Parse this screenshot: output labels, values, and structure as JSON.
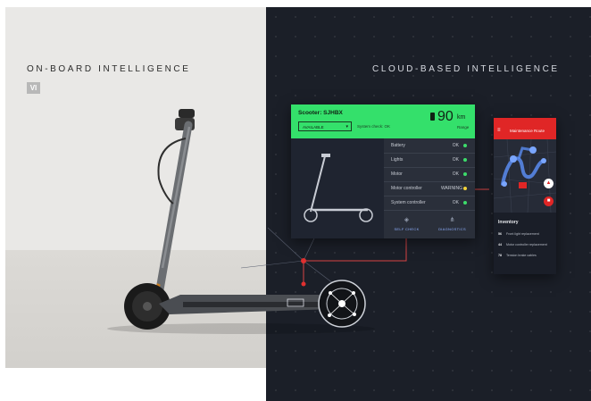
{
  "headers": {
    "left": "ON-BOARD INTELLIGENCE",
    "right": "CLOUD-BASED INTELLIGENCE",
    "badge": "VI"
  },
  "dashboard": {
    "title": "Scooter: SJHBX",
    "status": "AVAILABLE",
    "system_check": "System check: OK",
    "range_value": "90",
    "range_unit": "km",
    "range_label": "Range",
    "components": [
      {
        "name": "Battery",
        "status": "OK",
        "color": "#3ddc6b"
      },
      {
        "name": "Lights",
        "status": "OK",
        "color": "#3ddc6b"
      },
      {
        "name": "Motor",
        "status": "OK",
        "color": "#3ddc6b"
      },
      {
        "name": "Motor controller",
        "status": "WARNING",
        "color": "#f2d33a"
      },
      {
        "name": "System controller",
        "status": "OK",
        "color": "#3ddc6b"
      }
    ],
    "actions": [
      {
        "label": "SELF CHECK",
        "icon": "self-check-icon"
      },
      {
        "label": "DIAGNOSTICS",
        "icon": "diagnostics-icon"
      }
    ]
  },
  "phone": {
    "title": "Maintenance Route",
    "inventory_title": "Inventory",
    "items": [
      {
        "qty": "56",
        "label": "Front light replacement"
      },
      {
        "qty": "44",
        "label": "Motor controller replacement"
      },
      {
        "qty": "78",
        "label": "Tension brake cables"
      }
    ]
  },
  "colors": {
    "accent_green": "#34e06b",
    "accent_red": "#e02626",
    "warning": "#f2d33a",
    "dark_bg": "#1b1f28"
  }
}
